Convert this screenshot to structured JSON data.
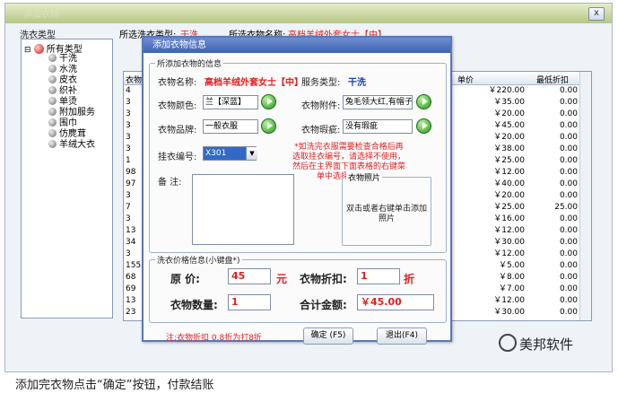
{
  "window": {
    "title": "添加衣物",
    "close": "x"
  },
  "info_bar": {
    "service_label": "所选洗衣类型:",
    "service_value": "干洗",
    "name_label": "所选衣物名称:",
    "name_value": "高档羊绒外套女士【中】"
  },
  "tree": {
    "title": "洗衣类型",
    "root": "所有类型",
    "items": [
      "干洗",
      "水洗",
      "皮衣",
      "织补",
      "单烫",
      "附加服务",
      "围巾",
      "仿麂茸",
      "羊绒大衣"
    ]
  },
  "table": {
    "columns": [
      "衣物",
      "单价",
      "最低折扣"
    ],
    "rows": [
      {
        "id": "4",
        "price": "￥220.00",
        "disc": "0.00"
      },
      {
        "id": "3",
        "price": "￥35.00",
        "disc": "0.00"
      },
      {
        "id": "3",
        "price": "￥20.00",
        "disc": "0.00"
      },
      {
        "id": "3",
        "price": "￥45.00",
        "disc": "0.00"
      },
      {
        "id": "3",
        "price": "￥20.00",
        "disc": "0.00"
      },
      {
        "id": "3",
        "price": "￥38.00",
        "disc": "0.00"
      },
      {
        "id": "1",
        "price": "￥25.00",
        "disc": "0.00"
      },
      {
        "id": "98",
        "price": "￥12.00",
        "disc": "0.00"
      },
      {
        "id": "97",
        "price": "￥40.00",
        "disc": "0.00"
      },
      {
        "id": "3",
        "price": "￥20.00",
        "disc": "0.00"
      },
      {
        "id": "7",
        "price": "￥25.00",
        "disc": "25.00"
      },
      {
        "id": "3",
        "price": "￥16.00",
        "disc": "0.00"
      },
      {
        "id": "13",
        "price": "￥12.00",
        "disc": "0.00"
      },
      {
        "id": "34",
        "price": "￥30.00",
        "disc": "0.00"
      },
      {
        "id": "3",
        "price": "￥12.00",
        "disc": "0.00"
      },
      {
        "id": "155",
        "price": "￥5.00",
        "disc": "0.00"
      },
      {
        "id": "68",
        "price": "￥8.00",
        "disc": "0.00"
      },
      {
        "id": "69",
        "price": "￥7.00",
        "disc": "0.00"
      },
      {
        "id": "13",
        "price": "￥12.00",
        "disc": "0.00"
      },
      {
        "id": "23",
        "price": "￥30.00",
        "disc": "0.00"
      }
    ]
  },
  "background_button": "返回",
  "dialog": {
    "title": "添加衣物信息",
    "group_info": "所添加衣物的信息",
    "cloth_name_label": "衣物名称:",
    "cloth_name_value": "高档羊绒外套女士【中】",
    "service_type_label": "服务类型:",
    "service_type_value": "干洗",
    "color_label": "衣物颜色:",
    "color_value": "兰【深蓝】",
    "attach_label": "衣物附件:",
    "attach_value": "兔毛领大红,有帽子",
    "brand_label": "衣物品牌:",
    "brand_value": "一般衣服",
    "flaw_label": "衣物瑕疵:",
    "flaw_value": "没有瑕疵",
    "hanger_label": "挂衣编号:",
    "hanger_value": "X301",
    "warning": "*如洗完衣服需要检查合格后再选取挂衣编号，请选择不使用，然后在主界面下面表格的右键菜单中选择挂衣编号",
    "memo_label": "备  注:",
    "photo_label": "衣物照片",
    "photo_hint": "双击或者右键单击添加照片",
    "group_price": "洗衣价格信息(小键盘*)",
    "orig_price_label": "原    价:",
    "orig_price_value": "45",
    "unit_yuan": "元",
    "discount_label": "衣物折扣:",
    "discount_value": "1",
    "unit_zhe": "折",
    "qty_label": "衣物数量:",
    "qty_value": "1",
    "total_label": "合计金额:",
    "total_value": "￥45.00",
    "note": "注:衣物折扣 0.8折为打8折",
    "ok_button": "确定 (F5)",
    "exit_button": "退出(F4)"
  },
  "watermark": "美邦软件",
  "caption": "添加完衣物点击“确定”按钮，付款结账"
}
